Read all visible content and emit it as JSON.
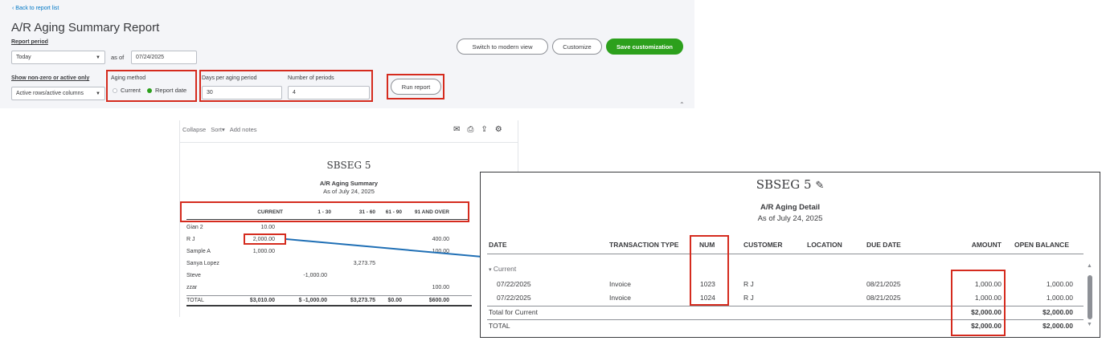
{
  "top": {
    "back_link": "Back to report list",
    "title": "A/R Aging Summary Report",
    "report_period_label": "Report period",
    "report_period_value": "Today",
    "as_of_label": "as of",
    "as_of_date": "07/24/2025",
    "show_label": "Show non-zero or active only",
    "show_value": "Active rows/active columns",
    "aging_method_label": "Aging method",
    "aging_current": "Current",
    "aging_report_date": "Report date",
    "days_label": "Days per aging period",
    "days_value": "30",
    "periods_label": "Number of periods",
    "periods_value": "4",
    "run_report": "Run report",
    "switch_modern": "Switch to modern view",
    "customize": "Customize",
    "save_customization": "Save customization"
  },
  "summary": {
    "toolbar": {
      "collapse": "Collapse",
      "sort": "Sort",
      "add_notes": "Add notes"
    },
    "company": "SBSEG 5",
    "report_name": "A/R Aging Summary",
    "as_of": "As of July 24, 2025",
    "columns": [
      "CURRENT",
      "1 - 30",
      "31 - 60",
      "61 - 90",
      "91 AND OVER"
    ],
    "rows": [
      {
        "name": "Gian 2",
        "current": "10.00",
        "d1_30": "",
        "d31_60": "",
        "d61_90": "",
        "d91": ""
      },
      {
        "name": "R J",
        "current": "2,000.00",
        "d1_30": "",
        "d31_60": "",
        "d61_90": "",
        "d91": "400.00"
      },
      {
        "name": "Sample A",
        "current": "1,000.00",
        "d1_30": "",
        "d31_60": "",
        "d61_90": "",
        "d91": "100.00"
      },
      {
        "name": "Sanya Lopez",
        "current": "",
        "d1_30": "",
        "d31_60": "3,273.75",
        "d61_90": "",
        "d91": ""
      },
      {
        "name": "Steve",
        "current": "",
        "d1_30": "-1,000.00",
        "d31_60": "",
        "d61_90": "",
        "d91": ""
      },
      {
        "name": "zzar",
        "current": "",
        "d1_30": "",
        "d31_60": "",
        "d61_90": "",
        "d91": "100.00"
      }
    ],
    "total": {
      "name": "TOTAL",
      "current": "$3,010.00",
      "d1_30": "$ -1,000.00",
      "d31_60": "$3,273.75",
      "d61_90": "$0.00",
      "d91": "$600.00"
    }
  },
  "detail": {
    "company": "SBSEG 5",
    "report_name": "A/R Aging Detail",
    "as_of": "As of July 24, 2025",
    "columns": {
      "date": "DATE",
      "type": "TRANSACTION TYPE",
      "num": "NUM",
      "customer": "CUSTOMER",
      "location": "LOCATION",
      "due": "DUE DATE",
      "amount": "AMOUNT",
      "open": "OPEN BALANCE"
    },
    "group_label": "Current",
    "rows": [
      {
        "date": "07/22/2025",
        "type": "Invoice",
        "num": "1023",
        "customer": "R J",
        "location": "",
        "due": "08/21/2025",
        "amount": "1,000.00",
        "open": "1,000.00"
      },
      {
        "date": "07/22/2025",
        "type": "Invoice",
        "num": "1024",
        "customer": "R J",
        "location": "",
        "due": "08/21/2025",
        "amount": "1,000.00",
        "open": "1,000.00"
      }
    ],
    "total_current": {
      "label": "Total for Current",
      "amount": "$2,000.00",
      "open": "$2,000.00"
    },
    "total": {
      "label": "TOTAL",
      "amount": "$2,000.00",
      "open": "$2,000.00"
    }
  },
  "colors": {
    "accent": "#2ca01c",
    "link": "#0077c5",
    "highlight": "#d52b1e",
    "arrow": "#1f6fb5"
  }
}
